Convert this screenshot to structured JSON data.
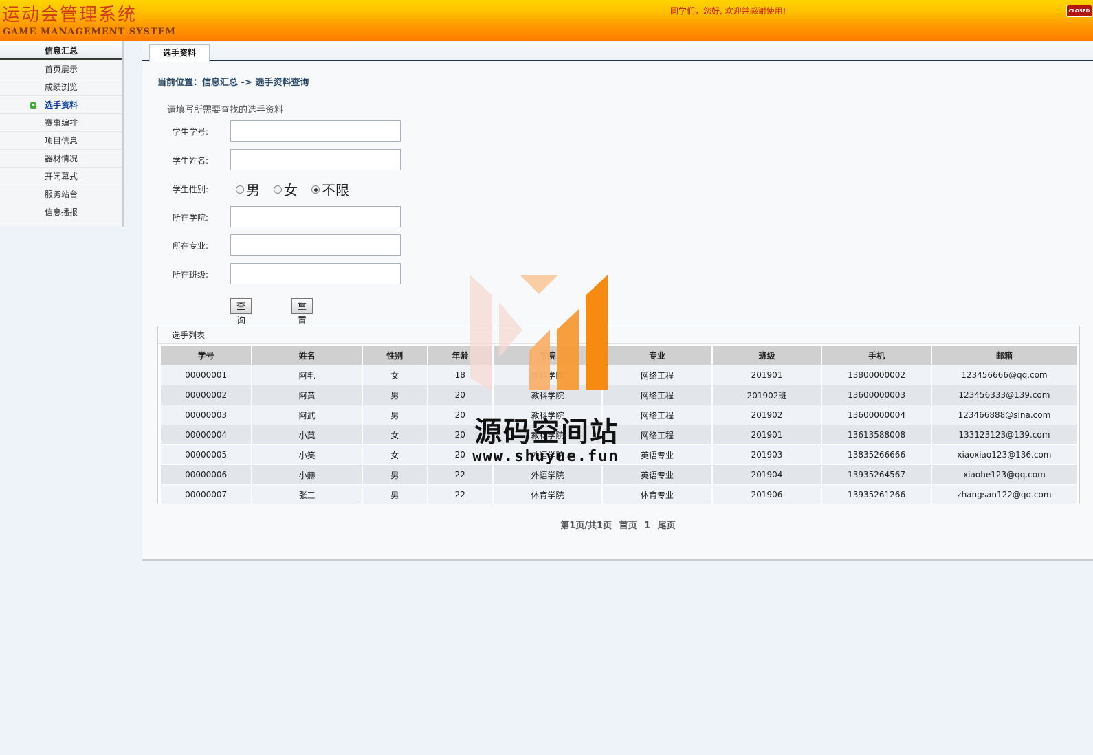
{
  "header": {
    "logo_cn": "运动会管理系统",
    "logo_en": "GAME  MANAGEMENT  SYSTEM",
    "welcome": "同学们，您好, 欢迎并感谢使用!",
    "close_label": "CLOSED"
  },
  "sidebar": {
    "title": "信息汇总",
    "items": [
      {
        "label": "首页展示",
        "active": false
      },
      {
        "label": "成绩浏览",
        "active": false
      },
      {
        "label": "选手资料",
        "active": true
      },
      {
        "label": "赛事编排",
        "active": false
      },
      {
        "label": "项目信息",
        "active": false
      },
      {
        "label": "器材情况",
        "active": false
      },
      {
        "label": "开闭幕式",
        "active": false
      },
      {
        "label": "服务站台",
        "active": false
      },
      {
        "label": "信息播报",
        "active": false
      }
    ]
  },
  "main": {
    "tab_label": "选手资料",
    "breadcrumb": "当前位置：信息汇总 -> 选手资料查询"
  },
  "form": {
    "title": "请填写所需要查找的选手资料",
    "student_id_label": "学生学号:",
    "student_id_value": "",
    "student_name_label": "学生姓名:",
    "student_name_value": "",
    "gender_label": "学生性别:",
    "gender_options": [
      "男",
      "女",
      "不限"
    ],
    "gender_selected": "不限",
    "college_label": "所在学院:",
    "college_value": "",
    "major_label": "所在专业:",
    "major_value": "",
    "class_label": "所在班级:",
    "class_value": "",
    "query_button": "查询",
    "reset_button": "重置"
  },
  "table": {
    "title": "选手列表",
    "columns": [
      "学号",
      "姓名",
      "性别",
      "年龄",
      "学院",
      "专业",
      "班级",
      "手机",
      "邮箱"
    ],
    "rows": [
      [
        "00000001",
        "阿毛",
        "女",
        "18",
        "教科学院",
        "网络工程",
        "201901",
        "13800000002",
        "123456666@qq.com"
      ],
      [
        "00000002",
        "阿黄",
        "男",
        "20",
        "教科学院",
        "网络工程",
        "201902班",
        "13600000003",
        "123456333@139.com"
      ],
      [
        "00000003",
        "阿武",
        "男",
        "20",
        "教科学院",
        "网络工程",
        "201902",
        "13600000004",
        "123466888@sina.com"
      ],
      [
        "00000004",
        "小莫",
        "女",
        "20",
        "教科学院",
        "网络工程",
        "201901",
        "13613588008",
        "133123123@139.com"
      ],
      [
        "00000005",
        "小笑",
        "女",
        "20",
        "外语学院",
        "英语专业",
        "201903",
        "13835266666",
        "xiaoxiao123@136.com"
      ],
      [
        "00000006",
        "小赫",
        "男",
        "22",
        "外语学院",
        "英语专业",
        "201904",
        "13935264567",
        "xiaohe123@qq.com"
      ],
      [
        "00000007",
        "张三",
        "男",
        "22",
        "体育学院",
        "体育专业",
        "201906",
        "13935261266",
        "zhangsan122@qq.com"
      ]
    ]
  },
  "pager": {
    "summary": "第1页/共1页",
    "first": "首页",
    "current": "1",
    "last": "尾页"
  },
  "watermark": {
    "text": "源码空间站",
    "url": "www.shuyue.fun"
  },
  "colors": {
    "header_top": "#ffd400",
    "header_bottom": "#ff7a00",
    "accent_red": "#d01a12",
    "watermark_orange": "#f78a10"
  }
}
